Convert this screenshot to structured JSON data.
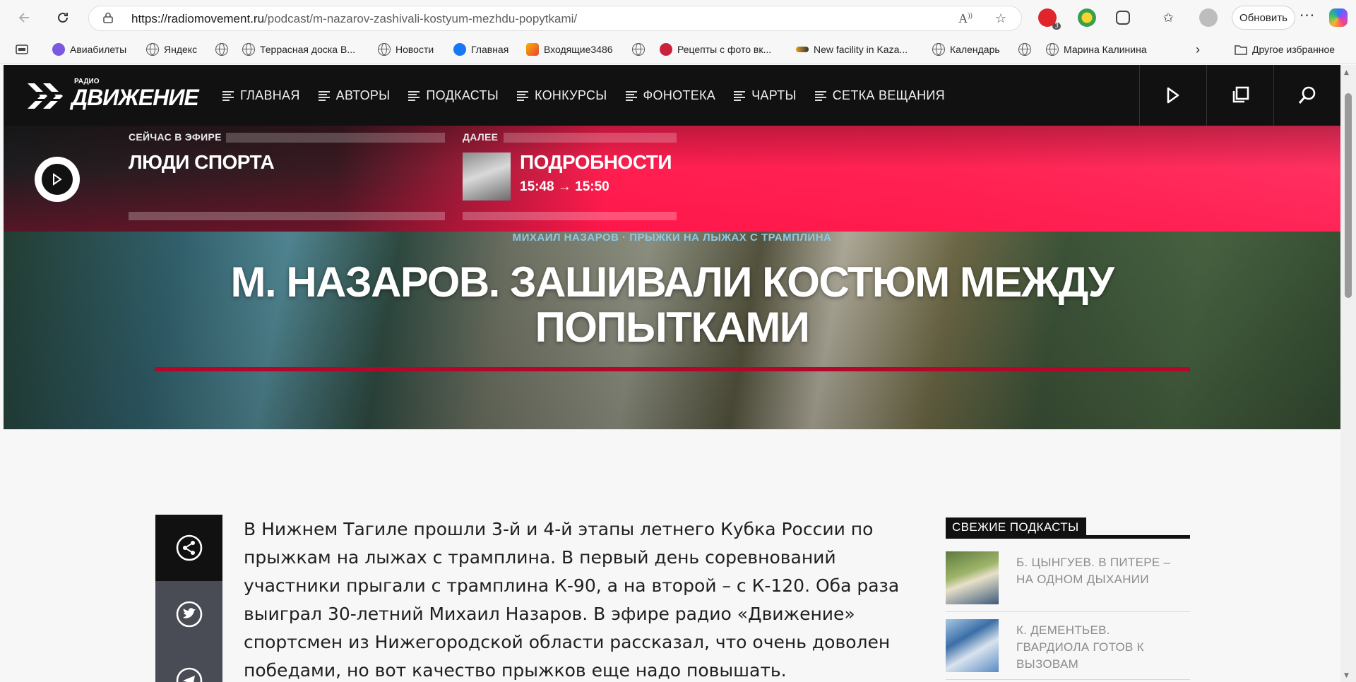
{
  "browser": {
    "url_host": "https://radiomovement.ru",
    "url_path": "/podcast/m-nazarov-zashivali-kostyum-mezhdu-popytkami/",
    "update_label": "Обновить",
    "more_label": "···",
    "badge_count": "3",
    "bookmarks": [
      {
        "label": "Авиабилеты",
        "icon": "aviasales-icon"
      },
      {
        "label": "Яндекс",
        "icon": "globe-icon"
      },
      {
        "label": "",
        "icon": "globe-icon"
      },
      {
        "label": "Террасная доска В...",
        "icon": "globe-icon"
      },
      {
        "label": "Новости",
        "icon": "globe-icon"
      },
      {
        "label": "Главная",
        "icon": "facebook-icon"
      },
      {
        "label": "Входящие3486",
        "icon": "mail-icon"
      },
      {
        "label": "",
        "icon": "globe-icon"
      },
      {
        "label": "Рецепты с фото вк...",
        "icon": "recipes-icon"
      },
      {
        "label": "New facility in Kaza...",
        "icon": "site-icon"
      },
      {
        "label": "Календарь",
        "icon": "globe-icon"
      },
      {
        "label": "",
        "icon": "globe-icon"
      },
      {
        "label": "Марина Калинина",
        "icon": "globe-icon"
      }
    ],
    "other_favorites": "Другое избранное"
  },
  "site": {
    "logo_radio": "РАДИО",
    "logo_word": "ДВИЖЕНИЕ",
    "menu": [
      "ГЛАВНАЯ",
      "АВТОРЫ",
      "ПОДКАСТЫ",
      "КОНКУРСЫ",
      "ФОНОТЕКА",
      "ЧАРТЫ",
      "СЕТКА ВЕЩАНИЯ"
    ]
  },
  "onair": {
    "now_label": "СЕЙЧАС В ЭФИРЕ",
    "now_title": "ЛЮДИ СПОРТА",
    "next_label": "ДАЛЕЕ",
    "next_title": "ПОДРОБНОСТИ",
    "next_time": "15:48 → 15:50"
  },
  "hero": {
    "tags": "МИХАИЛ НАЗАРОВ · ПРЫЖКИ НА ЛЫЖАХ С ТРАМПЛИНА",
    "title": "М. НАЗАРОВ. ЗАШИВАЛИ КОСТЮМ МЕЖДУ ПОПЫТКАМИ"
  },
  "article": {
    "text": "В Нижнем Тагиле прошли 3-й и 4-й этапы летнего Кубка России по прыжкам на лыжах с трамплина. В первый день соревнований участники прыгали с трамплина К-90, а на второй – с К-120. Оба раза выиграл 30-летний Михаил Назаров. В эфире радио «Движение» спортсмен из Нижегородской области рассказал, что очень доволен победами, но вот качество прыжков еще надо повышать."
  },
  "aside": {
    "heading": "СВЕЖИЕ ПОДКАСТЫ",
    "items": [
      {
        "title": "Б. ЦЫНГУЕВ. В ПИТЕРЕ – НА ОДНОМ ДЫХАНИИ"
      },
      {
        "title": "К. ДЕМЕНТЬЕВ. ГВАРДИОЛА ГОТОВ К ВЫЗОВАМ"
      }
    ]
  },
  "colors": {
    "accent": "#ff1e4f",
    "nav_bg": "#111111",
    "hero_line": "#b3082a",
    "tag_color": "#8ec9e4"
  }
}
